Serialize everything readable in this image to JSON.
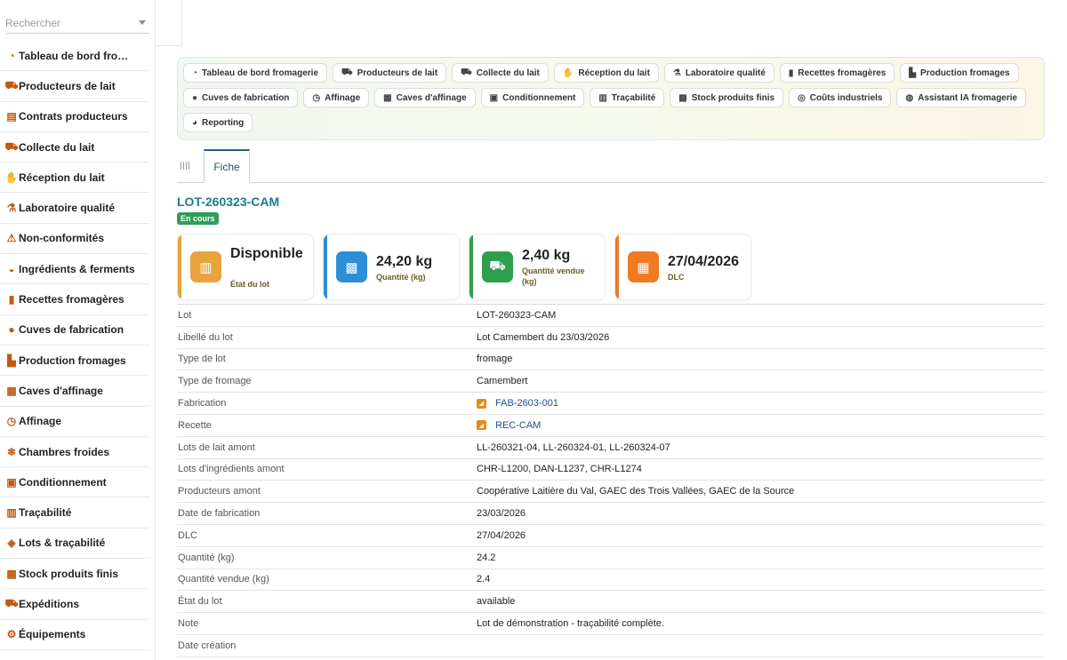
{
  "search": {
    "placeholder": "Rechercher"
  },
  "sidebar": {
    "items": [
      {
        "label": "Tableau de bord fro…",
        "icon": "dashboard-icon",
        "glyph": "◔"
      },
      {
        "label": "Producteurs de lait",
        "icon": "tractor-icon",
        "glyph": "⛟"
      },
      {
        "label": "Contrats producteurs",
        "icon": "document-icon",
        "glyph": "▤"
      },
      {
        "label": "Collecte du lait",
        "icon": "truck-icon",
        "glyph": "⛟"
      },
      {
        "label": "Réception du lait",
        "icon": "hand-icon",
        "glyph": "✋"
      },
      {
        "label": "Laboratoire qualité",
        "icon": "microscope-icon",
        "glyph": "⚗"
      },
      {
        "label": "Non-conformités",
        "icon": "warning-icon",
        "glyph": "⚠"
      },
      {
        "label": "Ingrédients & ferments",
        "icon": "mortar-icon",
        "glyph": "◒"
      },
      {
        "label": "Recettes fromagères",
        "icon": "book-icon",
        "glyph": "▮"
      },
      {
        "label": "Cuves de fabrication",
        "icon": "drop-icon",
        "glyph": "●"
      },
      {
        "label": "Production fromages",
        "icon": "industry-icon",
        "glyph": "▙"
      },
      {
        "label": "Caves d'affinage",
        "icon": "warehouse-icon",
        "glyph": "▦"
      },
      {
        "label": "Affinage",
        "icon": "clock-icon",
        "glyph": "◷"
      },
      {
        "label": "Chambres froides",
        "icon": "snowflake-icon",
        "glyph": "❄"
      },
      {
        "label": "Conditionnement",
        "icon": "box-icon",
        "glyph": "▣"
      },
      {
        "label": "Traçabilité",
        "icon": "barcode-icon",
        "glyph": "▥"
      },
      {
        "label": "Lots & traçabilité",
        "icon": "tags-icon",
        "glyph": "◈"
      },
      {
        "label": "Stock produits finis",
        "icon": "boxes-icon",
        "glyph": "▩"
      },
      {
        "label": "Expéditions",
        "icon": "shipping-icon",
        "glyph": "⛟"
      },
      {
        "label": "Équipements",
        "icon": "gears-icon",
        "glyph": "⚙"
      }
    ]
  },
  "nav": {
    "pills": [
      {
        "label": "Tableau de bord fromagerie",
        "icon": "dashboard-icon",
        "glyph": "◔"
      },
      {
        "label": "Producteurs de lait",
        "icon": "tractor-icon",
        "glyph": "⛟"
      },
      {
        "label": "Collecte du lait",
        "icon": "truck-icon",
        "glyph": "⛟"
      },
      {
        "label": "Réception du lait",
        "icon": "hand-icon",
        "glyph": "✋"
      },
      {
        "label": "Laboratoire qualité",
        "icon": "microscope-icon",
        "glyph": "⚗"
      },
      {
        "label": "Recettes fromagères",
        "icon": "book-icon",
        "glyph": "▮"
      },
      {
        "label": "Production fromages",
        "icon": "industry-icon",
        "glyph": "▙"
      },
      {
        "label": "Cuves de fabrication",
        "icon": "drop-icon",
        "glyph": "●"
      },
      {
        "label": "Affinage",
        "icon": "clock-icon",
        "glyph": "◷"
      },
      {
        "label": "Caves d'affinage",
        "icon": "warehouse-icon",
        "glyph": "▦"
      },
      {
        "label": "Conditionnement",
        "icon": "box-icon",
        "glyph": "▣"
      },
      {
        "label": "Traçabilité",
        "icon": "barcode-icon",
        "glyph": "▥"
      },
      {
        "label": "Stock produits finis",
        "icon": "boxes-icon",
        "glyph": "▩"
      },
      {
        "label": "Coûts industriels",
        "icon": "coins-icon",
        "glyph": "◎"
      },
      {
        "label": "Assistant IA fromagerie",
        "icon": "brain-icon",
        "glyph": "◍"
      },
      {
        "label": "Reporting",
        "icon": "chart-pie-icon",
        "glyph": "◕"
      }
    ]
  },
  "tabs": {
    "fiche": "Fiche"
  },
  "lot": {
    "title": "LOT-260323-CAM",
    "status": "En cours",
    "status_color": "#2e9e5b"
  },
  "cards": [
    {
      "value": "Disponible",
      "label": "État du lot",
      "color": "#e8a33d",
      "icon": "barcode-icon",
      "glyph": "▥"
    },
    {
      "value": "24,20 kg",
      "label": "Quantité (kg)",
      "color": "#2b8fd6",
      "icon": "boxes-icon",
      "glyph": "▩"
    },
    {
      "value": "2,40 kg",
      "label": "Quantité vendue (kg)",
      "color": "#2e9e4f",
      "icon": "shipping-icon",
      "glyph": "⛟"
    },
    {
      "value": "27/04/2026",
      "label": "DLC",
      "color": "#f07a22",
      "icon": "calendar-icon",
      "glyph": "▦"
    }
  ],
  "fields": [
    {
      "key": "Lot",
      "value": "LOT-260323-CAM"
    },
    {
      "key": "Libellé du lot",
      "value": "Lot Camembert du 23/03/2026"
    },
    {
      "key": "Type de lot",
      "value": "fromage"
    },
    {
      "key": "Type de fromage",
      "value": "Camembert"
    },
    {
      "key": "Fabrication",
      "value": "FAB-2603-001",
      "link": true
    },
    {
      "key": "Recette",
      "value": "REC-CAM",
      "link": true
    },
    {
      "key": "Lots de lait amont",
      "value": "LL-260321-04, LL-260324-01, LL-260324-07"
    },
    {
      "key": "Lots d'ingrédients amont",
      "value": "CHR-L1200, DAN-L1237, CHR-L1274"
    },
    {
      "key": "Producteurs amont",
      "value": "Coopérative Laitière du Val, GAEC des Trois Vallées, GAEC de la Source"
    },
    {
      "key": "Date de fabrication",
      "value": "23/03/2026"
    },
    {
      "key": "DLC",
      "value": "27/04/2026"
    },
    {
      "key": "Quantité (kg)",
      "value": "24.2"
    },
    {
      "key": "Quantité vendue (kg)",
      "value": "2.4"
    },
    {
      "key": "État du lot",
      "value": "available"
    },
    {
      "key": "Note",
      "value": "Lot de démonstration - traçabilité complète."
    },
    {
      "key": "Date création",
      "value": ""
    }
  ]
}
